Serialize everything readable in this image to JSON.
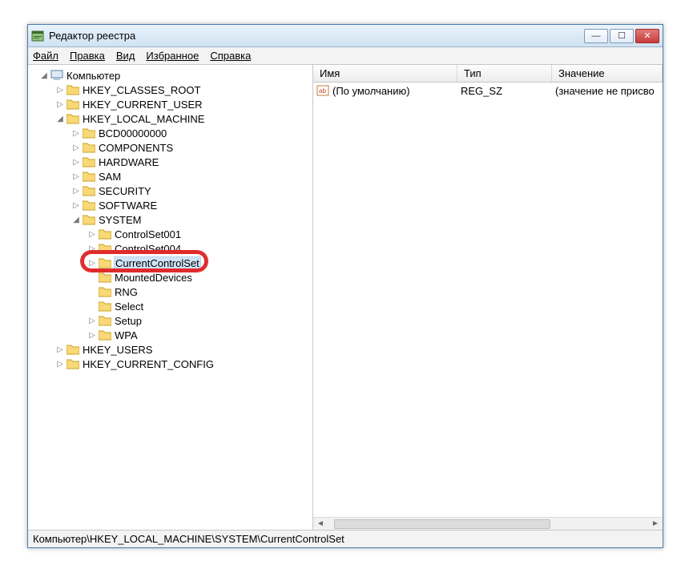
{
  "window": {
    "title": "Редактор реестра"
  },
  "menu": {
    "file": "Файл",
    "edit": "Правка",
    "view": "Вид",
    "favorites": "Избранное",
    "help": "Справка"
  },
  "tree": {
    "root": "Компьютер",
    "hkcr": "HKEY_CLASSES_ROOT",
    "hkcu": "HKEY_CURRENT_USER",
    "hklm": "HKEY_LOCAL_MACHINE",
    "hklm_children": {
      "bcd": "BCD00000000",
      "components": "COMPONENTS",
      "hardware": "HARDWARE",
      "sam": "SAM",
      "security": "SECURITY",
      "software": "SOFTWARE",
      "system": "SYSTEM"
    },
    "system_children": {
      "cs001": "ControlSet001",
      "cs004": "ControlSet004",
      "ccs": "CurrentControlSet",
      "mounted": "MountedDevices",
      "rng": "RNG",
      "select": "Select",
      "setup": "Setup",
      "wpa": "WPA"
    },
    "hku": "HKEY_USERS",
    "hkcc": "HKEY_CURRENT_CONFIG"
  },
  "columns": {
    "name": "Имя",
    "type": "Тип",
    "value": "Значение"
  },
  "list": {
    "rows": [
      {
        "name": "(По умолчанию)",
        "type": "REG_SZ",
        "value": "(значение не присво"
      }
    ]
  },
  "statusbar": {
    "path": "Компьютер\\HKEY_LOCAL_MACHINE\\SYSTEM\\CurrentControlSet"
  }
}
